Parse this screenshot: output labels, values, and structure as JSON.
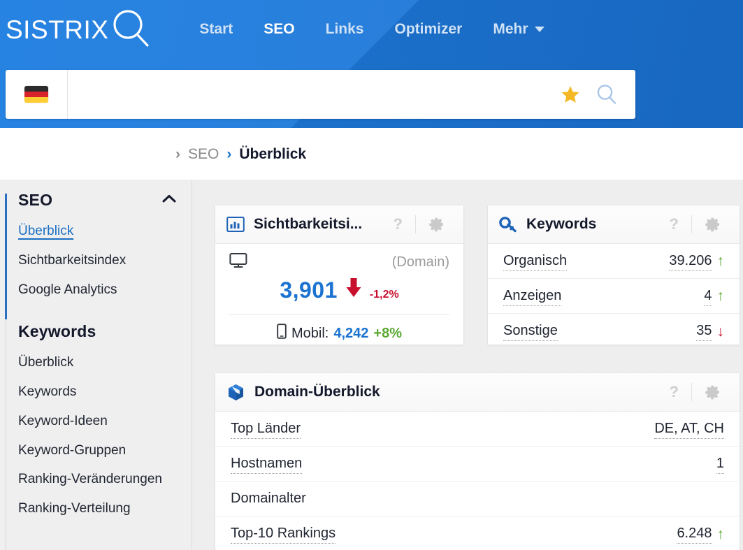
{
  "header": {
    "brand": "SISTRIX",
    "brand_icon": "magnifier-icon",
    "nav": [
      {
        "label": "Start",
        "active": false
      },
      {
        "label": "SEO",
        "active": true
      },
      {
        "label": "Links",
        "active": false
      },
      {
        "label": "Optimizer",
        "active": false
      },
      {
        "label": "Mehr",
        "active": false,
        "has_caret": true
      }
    ]
  },
  "search": {
    "country_flag": "de-flag-icon",
    "value": "",
    "placeholder": "",
    "star_icon": "star-icon",
    "search_icon": "search-icon"
  },
  "breadcrumb": {
    "sep1": "›",
    "item1": "SEO",
    "sep2": "›",
    "current": "Überblick"
  },
  "sidebar": {
    "groups": [
      {
        "title": "SEO",
        "collapse_icon": "chevron-up-icon",
        "items": [
          {
            "label": "Überblick",
            "active": true
          },
          {
            "label": "Sichtbarkeitsindex",
            "active": false
          },
          {
            "label": "Google Analytics",
            "active": false
          }
        ]
      },
      {
        "title": "Keywords",
        "items": [
          {
            "label": "Überblick",
            "active": false
          },
          {
            "label": "Keywords",
            "active": false
          },
          {
            "label": "Keyword-Ideen",
            "active": false
          },
          {
            "label": "Keyword-Gruppen",
            "active": false
          },
          {
            "label": "Ranking-Veränderungen",
            "active": false
          },
          {
            "label": "Ranking-Verteilung",
            "active": false
          }
        ]
      }
    ]
  },
  "cards": {
    "visibility": {
      "icon": "bar-chart-icon",
      "title": "Sichtbarkeitsi...",
      "help": "?",
      "gear": "gear-icon",
      "device_icon": "desktop-icon",
      "scope": "(Domain)",
      "value": "3,901",
      "trend": "down",
      "delta": "-1,2%",
      "mobile_icon": "mobile-icon",
      "mobile_label": "Mobil:",
      "mobile_value": "4,242",
      "mobile_delta": "+8%"
    },
    "keywords": {
      "icon": "key-icon",
      "title": "Keywords",
      "help": "?",
      "gear": "gear-icon",
      "rows": [
        {
          "label": "Organisch",
          "value": "39.206",
          "trend": "up"
        },
        {
          "label": "Anzeigen",
          "value": "4",
          "trend": "up"
        },
        {
          "label": "Sonstige",
          "value": "35",
          "trend": "down"
        }
      ]
    },
    "domain_overview": {
      "icon": "cube-icon",
      "title": "Domain-Überblick",
      "help": "?",
      "gear": "gear-icon",
      "rows": [
        {
          "label": "Top Länder",
          "value": "DE, AT, CH",
          "trend": "none"
        },
        {
          "label": "Hostnamen",
          "value": "1",
          "trend": "none"
        },
        {
          "label": "Domainalter",
          "value": "",
          "trend": "none"
        },
        {
          "label": "Top-10 Rankings",
          "value": "6.248",
          "trend": "up"
        }
      ]
    }
  },
  "colors": {
    "brand_blue": "#1673d6",
    "accent_blue": "#1a73d0",
    "up_green": "#5aa832",
    "down_red": "#c8102e",
    "sidebar_bg": "#efefef",
    "body_bg": "#eeeeee"
  }
}
